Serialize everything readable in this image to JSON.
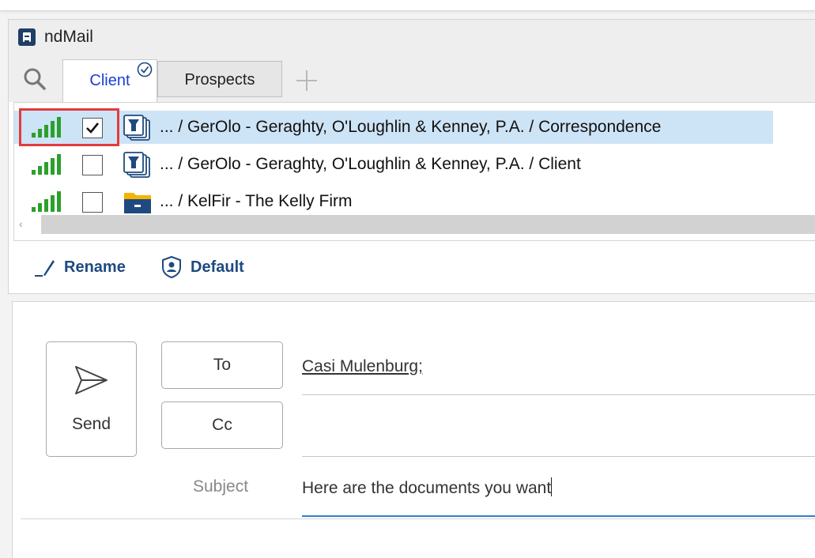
{
  "app": {
    "title": "ndMail"
  },
  "tabs": [
    {
      "label": "Client",
      "active": true
    },
    {
      "label": "Prospects",
      "active": false
    }
  ],
  "locations": [
    {
      "path": "... / GerOlo - Geraghty, O'Loughlin & Kenney, P.A. / Correspondence",
      "checked": true,
      "selected": true,
      "icon": "workspace-folder-icon",
      "signal_strength": 5
    },
    {
      "path": "... / GerOlo - Geraghty, O'Loughlin & Kenney, P.A. / Client",
      "checked": false,
      "selected": false,
      "icon": "workspace-folder-icon",
      "signal_strength": 5
    },
    {
      "path": "... / KelFir - The Kelly Firm",
      "checked": false,
      "selected": false,
      "icon": "cabinet-folder-icon",
      "signal_strength": 5
    }
  ],
  "scroll": {
    "left_arrow": "‹"
  },
  "actions": {
    "rename": "Rename",
    "default": "Default"
  },
  "compose": {
    "send_label": "Send",
    "to_label": "To",
    "cc_label": "Cc",
    "to_value": "Casi Mulenburg;",
    "cc_value": "",
    "subject_label": "Subject",
    "subject_value": "Here are the documents you want"
  },
  "colors": {
    "accent_tab": "#1a3fd6",
    "selection": "#cde4f7",
    "signal": "#2ca02c",
    "highlight": "#e23b3b",
    "action_text": "#1e4a80",
    "subject_underline": "#2f7fc8"
  }
}
